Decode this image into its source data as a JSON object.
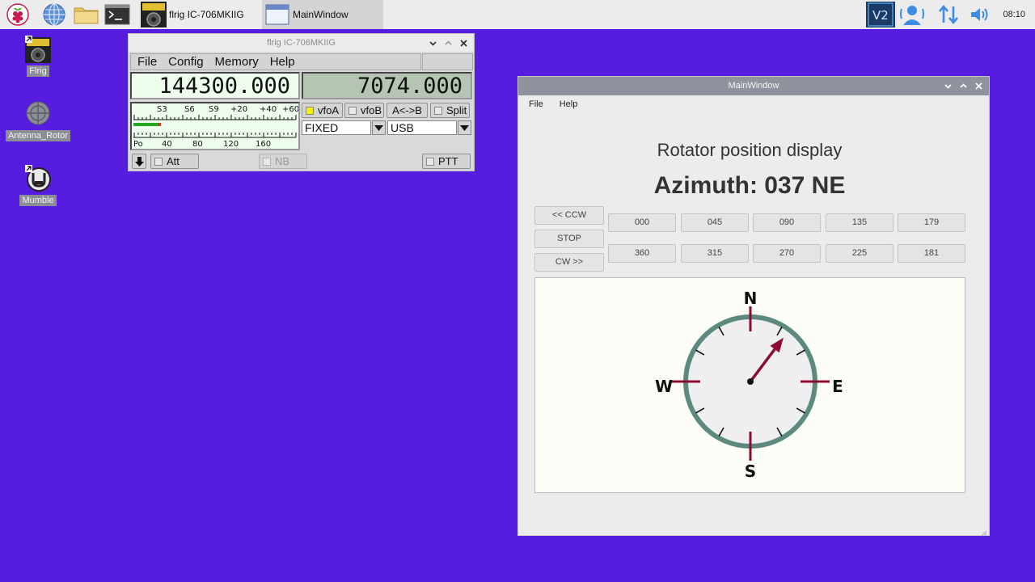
{
  "taskbar": {
    "launchers": [
      {
        "name": "raspberry-menu-icon"
      },
      {
        "name": "web-browser-icon"
      },
      {
        "name": "file-manager-icon"
      },
      {
        "name": "terminal-icon"
      }
    ],
    "tasks": [
      {
        "label": "flrig IC-706MKIIG",
        "active": false
      },
      {
        "label": "MainWindow",
        "active": true
      }
    ],
    "tray": [
      "vnc-icon",
      "bluetooth-icon",
      "network-icon",
      "volume-icon"
    ],
    "clock": "08:10"
  },
  "desktop": {
    "icons": [
      {
        "label": "Flrig"
      },
      {
        "label": "Antenna_Rotor"
      },
      {
        "label": "Mumble"
      }
    ]
  },
  "flrig": {
    "title": "flrig IC-706MKIIG",
    "menu": [
      "File",
      "Config",
      "Memory",
      "Help"
    ],
    "vfo_a_freq": "144300.000",
    "vfo_b_freq": "7074.000",
    "smeter_scale": [
      "S3",
      "S6",
      "S9",
      "+20",
      "+40",
      "+60"
    ],
    "power_scale": [
      "Po",
      "40",
      "80",
      "120",
      "160"
    ],
    "smeter_level": 0.17,
    "buttons": {
      "vfoa": "vfoA",
      "vfob": "vfoB",
      "a_to_b": "A<->B",
      "split": "Split",
      "att": "Att",
      "nb": "NB",
      "ptt": "PTT"
    },
    "bandwidth": "FIXED",
    "mode": "USB",
    "colors": {
      "vfoa_indicator": "#f5f500",
      "meter_fill": "#22aa22",
      "meter_peak": "#d43a1a"
    }
  },
  "mainwin": {
    "title": "MainWindow",
    "menu": [
      "File",
      "Help"
    ],
    "heading": "Rotator position display",
    "azimuth": "Azimuth: 037 NE",
    "azimuth_deg": 37,
    "control_buttons": [
      "<< CCW",
      "STOP",
      "CW >>"
    ],
    "preset_row1": [
      "000",
      "045",
      "090",
      "135",
      "179"
    ],
    "preset_row2": [
      "360",
      "315",
      "270",
      "225",
      "181"
    ],
    "compass": {
      "n": "N",
      "e": "E",
      "s": "S",
      "w": "W"
    },
    "colors": {
      "ring": "#5c8a7e",
      "pointer": "#8c0a35",
      "dial_bg": "#efeff2"
    }
  }
}
